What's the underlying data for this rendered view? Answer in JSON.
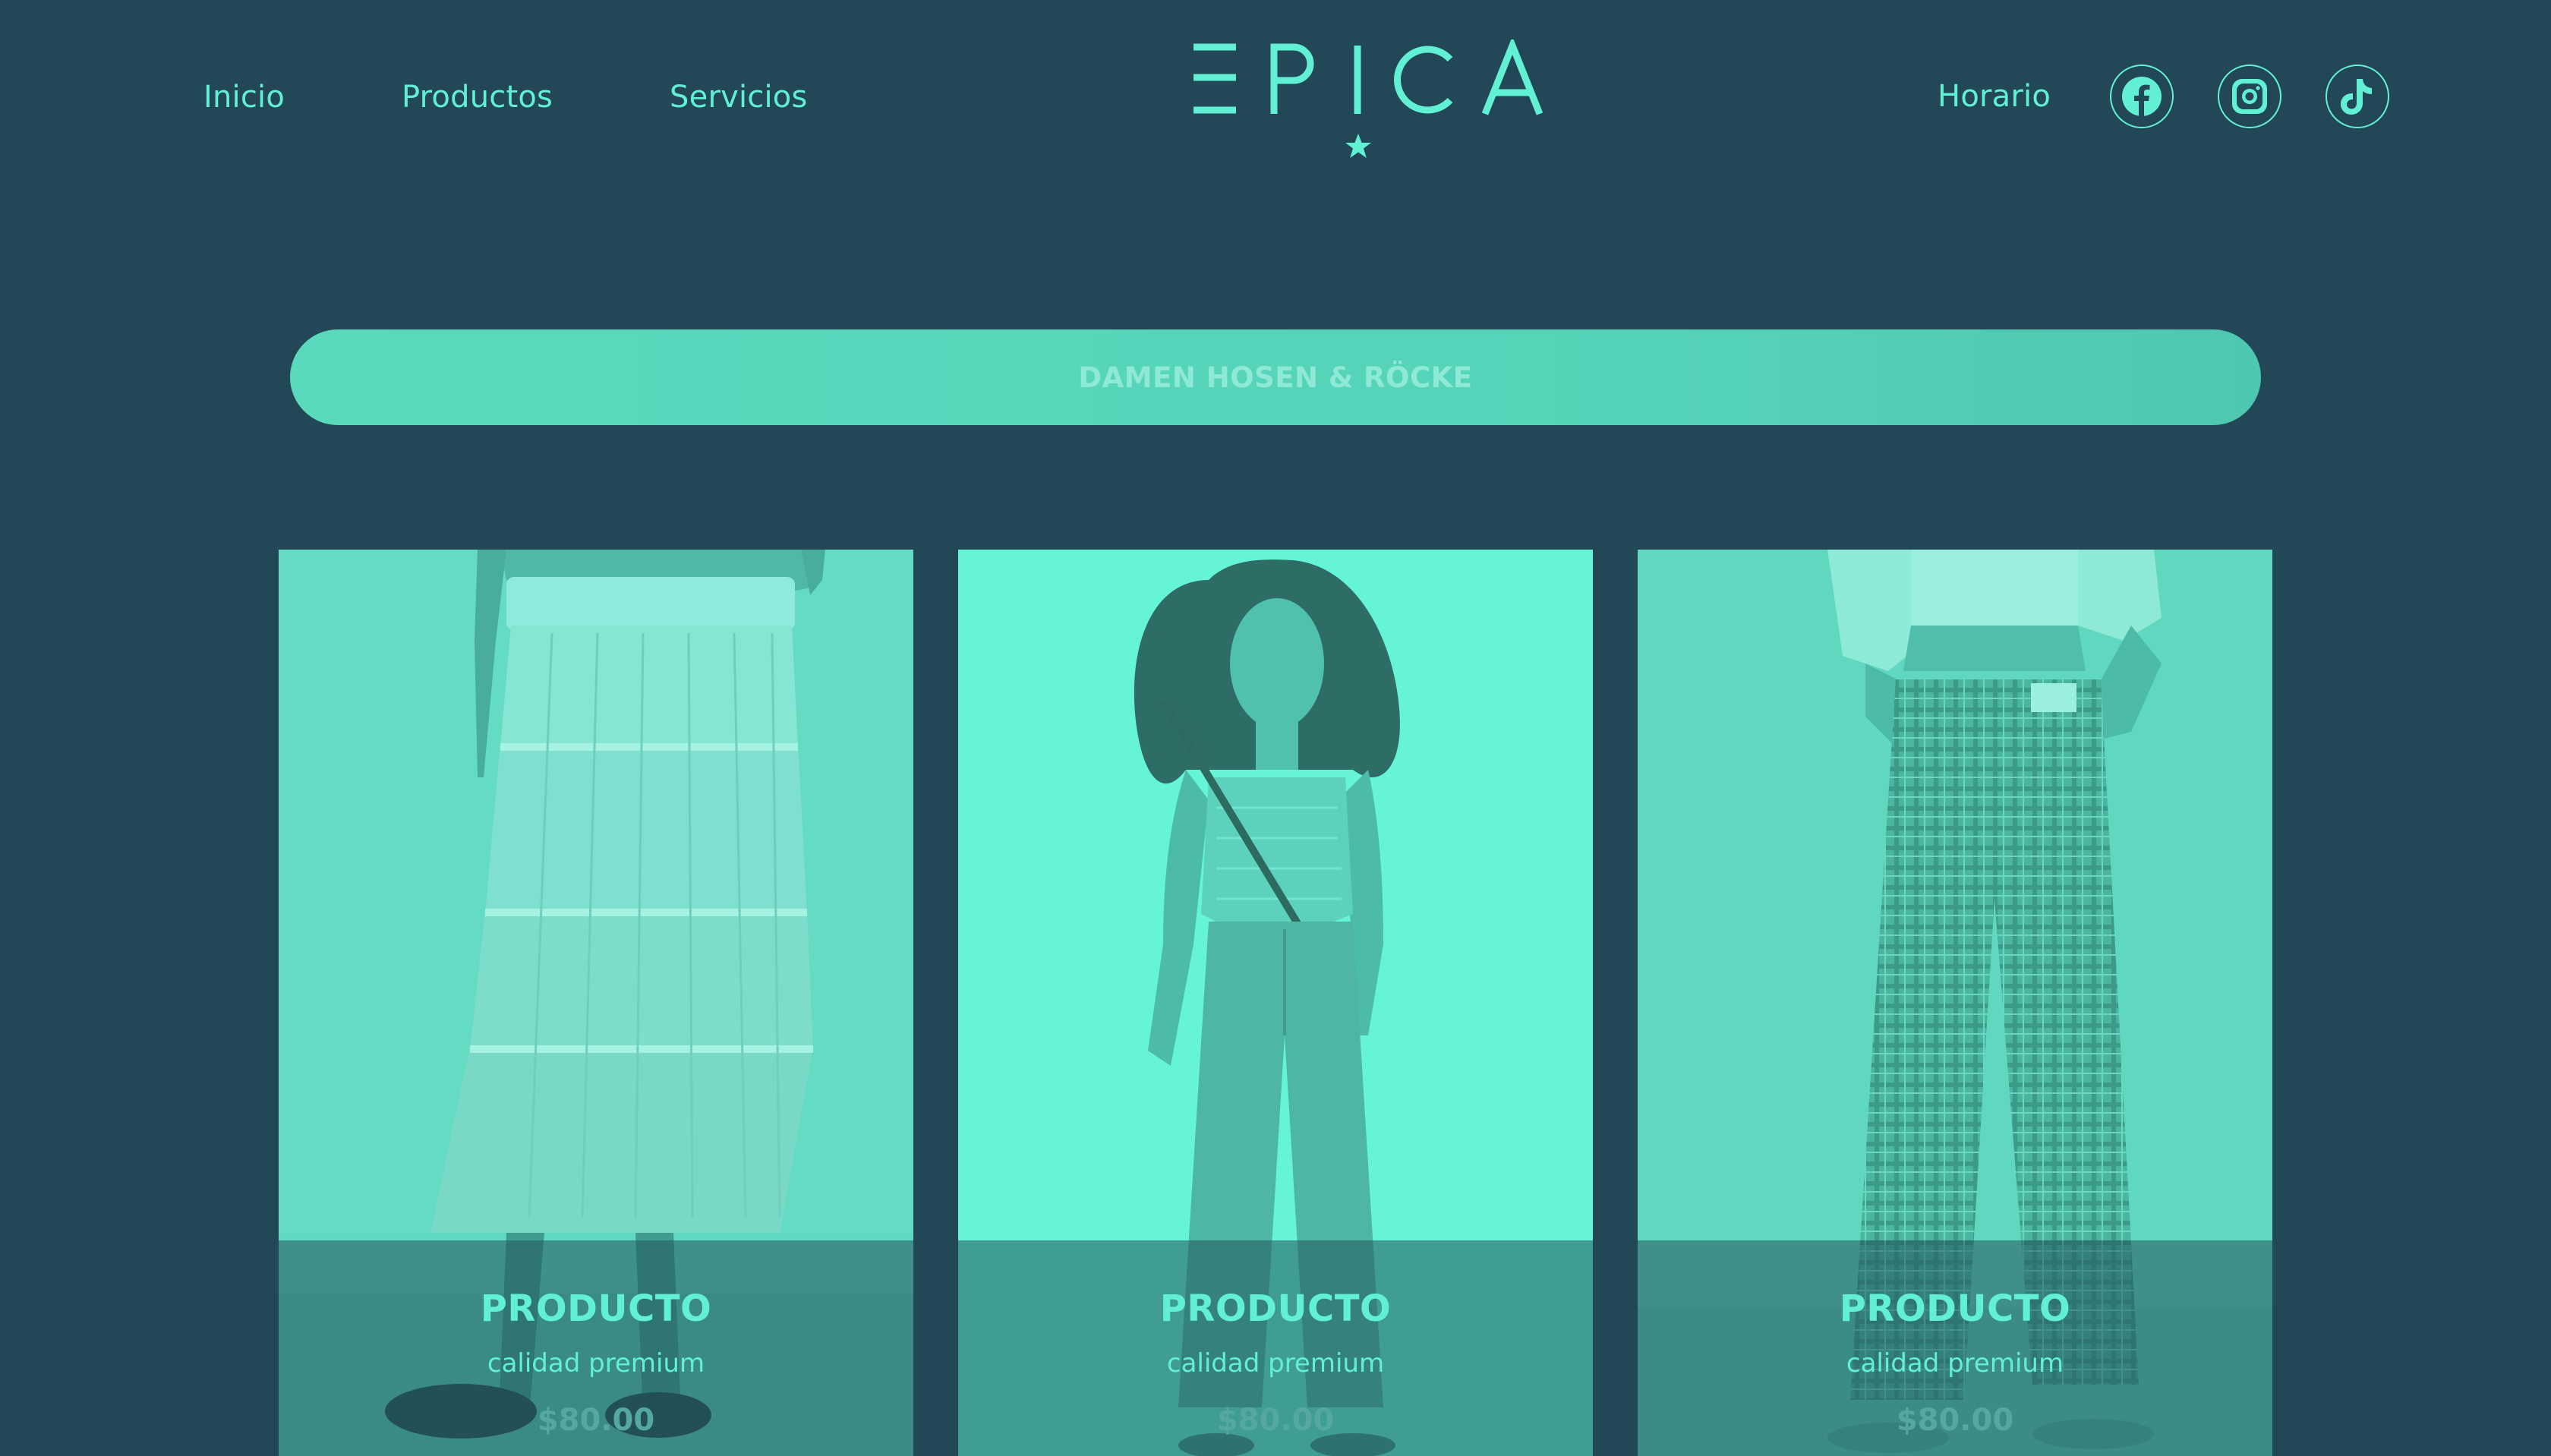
{
  "header": {
    "logo_text": "EPICA",
    "nav_left": [
      {
        "label": "Inicio"
      },
      {
        "label": "Productos"
      },
      {
        "label": "Servicios"
      }
    ],
    "nav_right": {
      "label": "Horario",
      "social": [
        {
          "icon": "facebook-icon"
        },
        {
          "icon": "instagram-icon"
        },
        {
          "icon": "tiktok-icon"
        }
      ]
    }
  },
  "category": {
    "title": "DAMEN HOSEN & RÖCKE"
  },
  "products": [
    {
      "name": "PRODUCTO",
      "description": "calidad premium",
      "price": "$80.00",
      "image": "skirt-photo"
    },
    {
      "name": "PRODUCTO",
      "description": "calidad premium",
      "price": "$80.00",
      "image": "wide-pants-photo"
    },
    {
      "name": "PRODUCTO",
      "description": "calidad premium",
      "price": "$80.00",
      "image": "plaid-pants-photo"
    }
  ],
  "colors": {
    "background": "#224858",
    "accent": "#61f0d3",
    "banner": "#55d3b8",
    "banner_text": "#8ee9d6",
    "price_text": "#54a8a0"
  }
}
